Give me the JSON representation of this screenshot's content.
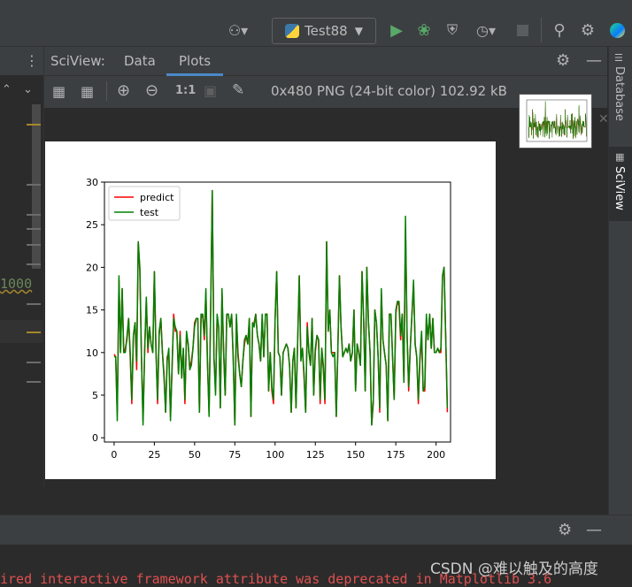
{
  "toolbar": {
    "run_config": "Test88",
    "colors": {
      "run": "#59a869",
      "debug": "#59a869",
      "accent": "#4a88c7"
    }
  },
  "sciview": {
    "title": "SciView:",
    "tabs": [
      {
        "label": "Data"
      },
      {
        "label": "Plots",
        "active": true
      }
    ],
    "file_info": "0x480 PNG (24-bit color) 102.92 kB",
    "zoom_actual": "1:1"
  },
  "left_gutter": {
    "visible_line_text": "1000"
  },
  "right_sidebar": {
    "items": [
      {
        "label": "Database"
      },
      {
        "label": "SciView",
        "active": true
      }
    ]
  },
  "console": {
    "text": "ired interactive framework attribute was deprecated in Matplotlib 3.6"
  },
  "watermark": "CSDN @难以触及的高度",
  "chart_data": {
    "type": "line",
    "legend": [
      "predict",
      "test"
    ],
    "legend_position": "top-left",
    "colors": {
      "predict": "#ff0000",
      "test": "#008000"
    },
    "xlim": [
      -6,
      209
    ],
    "ylim": [
      -0.5,
      30
    ],
    "xticks": [
      0,
      25,
      50,
      75,
      100,
      125,
      150,
      175,
      200
    ],
    "yticks": [
      0,
      5,
      10,
      15,
      20,
      25,
      30
    ],
    "series": [
      {
        "name": "predict",
        "x_start": 0,
        "x_step": 1,
        "values": [
          9.8,
          9.5,
          3.0,
          18.5,
          10.0,
          17.5,
          10.0,
          10.5,
          11.5,
          14.0,
          9.5,
          4.0,
          12.0,
          13.5,
          8.0,
          23.0,
          19.5,
          9.5,
          2.0,
          10.5,
          16.0,
          10.0,
          13.0,
          11.0,
          10.0,
          19.5,
          10.5,
          4.0,
          12.0,
          14.0,
          10.0,
          7.5,
          3.0,
          9.5,
          10.0,
          2.5,
          8.0,
          14.5,
          12.5,
          12.5,
          7.5,
          12.5,
          7.0,
          10.5,
          4.0,
          12.0,
          11.0,
          8.0,
          9.0,
          10.5,
          13.5,
          14.0,
          14.0,
          3.0,
          14.0,
          14.5,
          11.5,
          17.0,
          8.5,
          3.0,
          15.0,
          29.0,
          9.5,
          5.5,
          14.0,
          13.0,
          3.5,
          17.0,
          10.0,
          5.0,
          14.5,
          14.5,
          13.0,
          14.5,
          9.5,
          1.5,
          14.0,
          10.0,
          7.5,
          6.0,
          9.0,
          11.0,
          12.0,
          11.0,
          14.0,
          2.5,
          13.0,
          13.5,
          14.5,
          12.0,
          11.0,
          9.0,
          14.0,
          9.5,
          14.5,
          14.5,
          5.5,
          10.0,
          5.5,
          4.0,
          14.0,
          19.5,
          10.0,
          9.5,
          5.0,
          10.0,
          10.5,
          11.0,
          10.5,
          8.5,
          3.0,
          9.0,
          10.5,
          3.5,
          11.0,
          19.0,
          9.5,
          10.5,
          7.0,
          3.0,
          13.5,
          10.0,
          8.5,
          14.0,
          5.0,
          10.0,
          12.0,
          11.5,
          4.0,
          10.5,
          8.0,
          4.0,
          23.0,
          12.5,
          15.0,
          10.0,
          10.0,
          10.0,
          2.5,
          10.5,
          19.0,
          13.0,
          9.5,
          10.0,
          10.5,
          10.0,
          11.0,
          9.0,
          10.0,
          15.0,
          5.5,
          11.0,
          10.0,
          8.5,
          19.5,
          14.0,
          5.5,
          20.0,
          13.5,
          10.0,
          1.5,
          4.0,
          15.0,
          13.5,
          9.5,
          3.0,
          17.0,
          11.5,
          10.0,
          8.5,
          2.0,
          14.5,
          14.5,
          9.5,
          4.5,
          14.5,
          16.0,
          15.5,
          11.5,
          14.5,
          6.5,
          24.5,
          12.0,
          5.5,
          10.5,
          14.5,
          18.0,
          11.0,
          9.5,
          4.0,
          9.0,
          12.0,
          5.5,
          5.5,
          14.0,
          11.5,
          14.5,
          10.5,
          14.0,
          10.0,
          10.0,
          10.5,
          10.0,
          10.0,
          19.0,
          20.0,
          12.0,
          3.0
        ]
      },
      {
        "name": "test",
        "x_start": 0,
        "x_step": 1,
        "values": [
          9.5,
          9.5,
          2.0,
          19.0,
          10.0,
          17.5,
          10.0,
          10.0,
          12.0,
          14.0,
          10.0,
          4.5,
          12.0,
          13.5,
          9.0,
          23.0,
          20.0,
          9.5,
          1.5,
          10.5,
          16.5,
          10.5,
          13.0,
          11.0,
          10.0,
          19.5,
          10.0,
          4.5,
          12.5,
          14.0,
          10.0,
          7.0,
          3.0,
          9.0,
          10.5,
          2.0,
          8.5,
          14.0,
          13.0,
          12.5,
          7.5,
          12.0,
          7.0,
          10.5,
          4.5,
          12.5,
          11.0,
          8.0,
          8.5,
          10.5,
          13.0,
          14.0,
          14.0,
          3.0,
          14.5,
          14.5,
          12.0,
          17.5,
          9.0,
          2.5,
          15.0,
          29.0,
          9.5,
          5.0,
          14.5,
          13.0,
          3.5,
          17.5,
          10.5,
          5.0,
          14.5,
          14.5,
          13.0,
          14.5,
          9.0,
          1.5,
          14.5,
          9.5,
          7.5,
          6.0,
          9.0,
          11.5,
          12.0,
          11.0,
          14.0,
          2.5,
          13.5,
          13.0,
          14.5,
          12.0,
          11.0,
          9.0,
          14.5,
          9.5,
          14.5,
          14.5,
          5.5,
          10.0,
          6.0,
          4.5,
          14.0,
          19.5,
          10.0,
          9.5,
          5.0,
          10.0,
          10.5,
          11.0,
          10.5,
          8.5,
          3.0,
          9.0,
          10.5,
          3.5,
          11.0,
          19.0,
          9.0,
          10.5,
          7.5,
          3.0,
          13.0,
          10.0,
          8.5,
          14.0,
          5.0,
          10.5,
          12.0,
          11.5,
          4.5,
          10.5,
          8.5,
          4.5,
          23.0,
          12.5,
          15.0,
          10.0,
          9.5,
          10.0,
          2.5,
          10.5,
          19.0,
          13.0,
          9.5,
          10.0,
          10.5,
          10.0,
          11.0,
          9.0,
          10.0,
          15.0,
          5.5,
          11.0,
          10.0,
          8.5,
          19.5,
          14.0,
          5.5,
          20.0,
          13.5,
          10.0,
          1.5,
          4.5,
          15.0,
          13.5,
          9.5,
          3.5,
          17.5,
          11.5,
          10.0,
          8.5,
          2.0,
          14.5,
          14.5,
          9.5,
          4.5,
          15.0,
          16.0,
          16.0,
          12.0,
          14.5,
          6.5,
          26.0,
          12.0,
          6.0,
          10.5,
          14.5,
          18.5,
          11.0,
          9.5,
          4.5,
          9.5,
          12.5,
          5.5,
          6.0,
          14.5,
          11.5,
          14.5,
          10.5,
          14.0,
          10.0,
          10.0,
          10.5,
          10.0,
          10.5,
          19.0,
          20.0,
          12.0,
          3.5
        ]
      }
    ]
  }
}
